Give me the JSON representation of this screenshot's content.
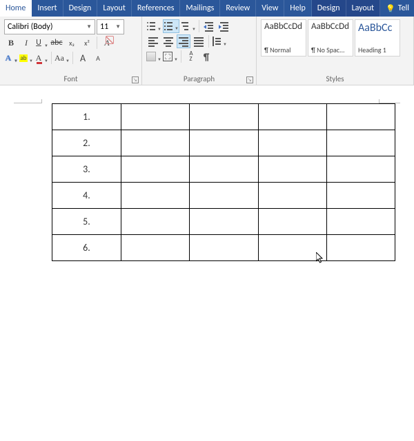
{
  "tabs": {
    "main": [
      "Home",
      "Insert",
      "Design",
      "Layout",
      "References",
      "Mailings",
      "Review",
      "View",
      "Help"
    ],
    "context": [
      "Design",
      "Layout"
    ],
    "tell": "Tell"
  },
  "font": {
    "group_label": "Font",
    "name": "Calibri (Body)",
    "size": "11",
    "bold": "B",
    "italic": "I",
    "underline": "U",
    "strike": "abc",
    "sub": "x₂",
    "sup": "x²",
    "clear_label": "A",
    "effects": "A",
    "highlight": "ab",
    "color": "A",
    "case": "Aa",
    "grow": "A",
    "shrink": "A",
    "grow_caret": "ˆ",
    "shrink_caret": "ˇ"
  },
  "paragraph": {
    "group_label": "Paragraph",
    "sort": "A\nZ",
    "pilcrow": "¶"
  },
  "styles": {
    "group_label": "Styles",
    "items": [
      {
        "preview": "AaBbCcDd",
        "label": "¶ Normal"
      },
      {
        "preview": "AaBbCcDd",
        "label": "¶ No Spac..."
      },
      {
        "preview": "AaBbCc",
        "label": "Heading 1"
      }
    ]
  },
  "table": {
    "rows": [
      "1.",
      "2.",
      "3.",
      "4.",
      "5.",
      "6."
    ],
    "cols": 5
  },
  "colors": {
    "accent": "#2b579a",
    "font_underline": "#d13438",
    "highlight": "#ffff00"
  }
}
